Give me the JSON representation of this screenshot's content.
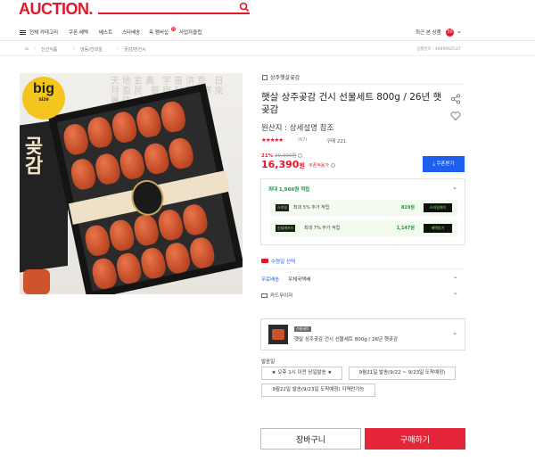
{
  "header": {
    "logo": "AUCTION.",
    "recent_label": "최근 본 상품",
    "recent_count": "30"
  },
  "nav": {
    "menu_label": "전체 카테고리",
    "items": [
      "쿠폰·혜택",
      "베스트",
      "스타배송",
      "옥 멤버십",
      "사업자클럽"
    ],
    "badge": "N"
  },
  "breadcrumb": {
    "items": [
      "신선식품",
      "냉동/건과일",
      "곶감/반건시"
    ],
    "product_no": "상품번호 : 4849962537"
  },
  "product_image": {
    "badge_big": "big",
    "badge_sub": "size",
    "box_text": "곶감",
    "calligraphy": "天地玄黃 宇宙洪荒 日月盈昃 辰宿列張 寒來暑往 秋收冬藏"
  },
  "product": {
    "seller": "상주햇살곶감",
    "title": "햇살 상주곶감 건시 선물세트 800g / 26년 햇곶감",
    "origin": "원산지 : 상세설명 참조",
    "stars": "★★★★★",
    "rating_count": "(67)",
    "purchase": "구매 221",
    "discount": "21%",
    "original_price": "20,900원",
    "price": "16,390",
    "price_unit": "원",
    "coupon_price_label": "쿠폰적용가",
    "coupon_button": "쿠폰받기"
  },
  "points": {
    "head_prefix": "최대",
    "head_amount": "1,966원",
    "head_suffix": "적립",
    "rows": [
      {
        "badge": "스마일",
        "text": "최대 5% 추가 적립",
        "amount": "819원",
        "button": "스마일페이"
      },
      {
        "badge": "신세계카드",
        "text": "최대 7% 추가 적립",
        "amount": "1,147원",
        "button": "혜택받기"
      }
    ]
  },
  "options": {
    "delivery_select": "수령일 선택",
    "shipping_label": "무료배송",
    "shipping_value": "우체국택배",
    "card_label": "카드무이자"
  },
  "selected": {
    "tag": "선물세트",
    "name": "햇살 상주곶감 건시 선물세트 800g / 26년 햇곶감"
  },
  "shipping": {
    "label": "발송일",
    "options": [
      "★ 오후 1시 이전 당일발송 ★",
      "9월21일 발송(9/22 ~ 9/23일 도착예정)",
      "9월22일 발송(9/23일 도착예정) 지역만가능"
    ]
  },
  "actions": {
    "cart": "장바구니",
    "buy": "구매하기"
  },
  "colors": {
    "brand": "#e4162b",
    "blue": "#1c5ff0",
    "green": "#109a3e"
  }
}
